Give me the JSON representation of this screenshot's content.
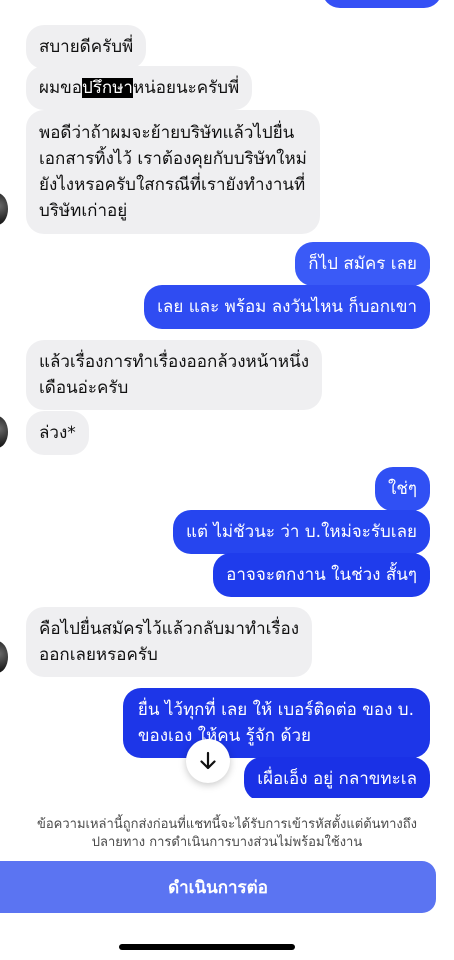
{
  "colors": {
    "incoming_bg": "#efeff1",
    "outgoing_top": "#5a72ff",
    "outgoing_bottom": "#1a2fe8",
    "button_bg": "#5b74f2"
  },
  "messages": [
    {
      "side": "in",
      "parts": [
        "สบายดีครับพี่"
      ]
    },
    {
      "side": "in",
      "parts": [
        "ผมขอ",
        "ปรึกษา",
        "หน่อยนะครับพี่"
      ]
    },
    {
      "side": "in",
      "lines": [
        "พอดีว่าถ้าผมจะย้ายบริษัทแล้วไปยื่น",
        "เอกสารทิ้งไว้ เราต้องคุยกับบริษัทใหม่",
        "ยังไงหรอครับใสกรณีที่เรายังทำงานที่",
        "บริษัทเก่าอยู่"
      ]
    },
    {
      "side": "out",
      "text": "ก็ไป  สมัคร เลย"
    },
    {
      "side": "out",
      "text": "เลย และ พร้อม ลงวันไหน ก็บอกเขา"
    },
    {
      "side": "in",
      "lines": [
        "แล้วเรื่องการทำเรื่องออกล้วงหน้าหนึ่ง",
        "เดือนอ่ะครับ"
      ]
    },
    {
      "side": "in",
      "text": "ล่วง*"
    },
    {
      "side": "out",
      "text": "ใช่ๆ"
    },
    {
      "side": "out",
      "text": "แต่ ไม่ชัวนะ ว่า บ.ใหม่จะรับเลย"
    },
    {
      "side": "out",
      "text": "อาจจะตกงาน ในช่วง สั้นๆ"
    },
    {
      "side": "in",
      "lines": [
        "คือไปยื่นสมัครไว้แล้วกลับมาทำเรื่อง",
        "ออกเลยหรอครับ"
      ]
    },
    {
      "side": "out",
      "lines": [
        "ยื่น ไว้ทุกที่ เลย  ให้ เบอร์ติดต่อ  ของ บ.",
        "ของเอง ให้คน รู้จัก  ด้วย"
      ]
    },
    {
      "side": "out",
      "text": "เผื่อเอ็ง อยู่ กลาขทะเล"
    }
  ],
  "scroll_down_icon": "arrow-down-icon",
  "notice": {
    "line1": "ข้อความเหล่านี้ถูกส่งก่อนที่แชทนี้จะได้รับการเข้ารหัสตั้งแต่ต้นทางถึง",
    "line2": "ปลายทาง การดำเนินการบางส่วนไม่พร้อมใช้งาน"
  },
  "continue_button": "ดำเนินการต่อ"
}
